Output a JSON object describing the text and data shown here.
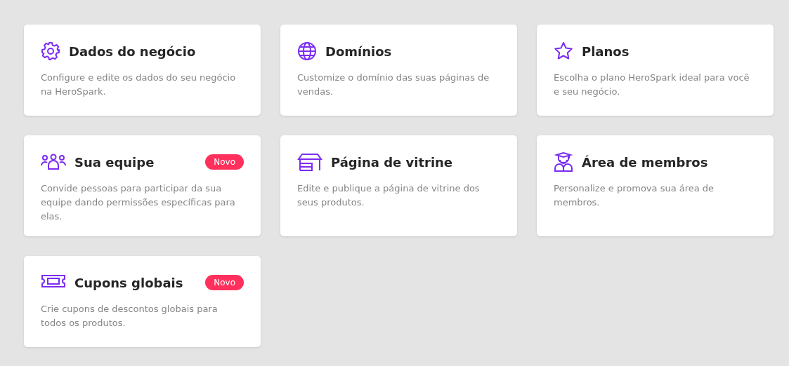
{
  "cards": [
    {
      "kind": "gear",
      "title": "Dados do negócio",
      "description": "Configure e edite os dados do seu negócio na HeroSpark."
    },
    {
      "kind": "globe",
      "title": "Domínios",
      "description": "Customize o domínio das suas páginas de vendas."
    },
    {
      "kind": "star",
      "title": "Planos",
      "description": "Escolha o plano HeroSpark ideal para você e seu negócio."
    },
    {
      "kind": "people",
      "title": "Sua equipe",
      "badge": "Novo",
      "description": "Convide pessoas para participar da sua equipe dando permissões específicas para elas."
    },
    {
      "kind": "store",
      "title": "Página de vitrine",
      "description": "Edite e publique a página de vitrine dos seus produtos."
    },
    {
      "kind": "graduate",
      "title": "Área de membros",
      "description": "Personalize e promova sua área de membros."
    },
    {
      "kind": "ticket",
      "title": "Cupons globais",
      "badge": "Novo",
      "description": "Crie cupons de descontos globais para todos os produtos."
    }
  ]
}
